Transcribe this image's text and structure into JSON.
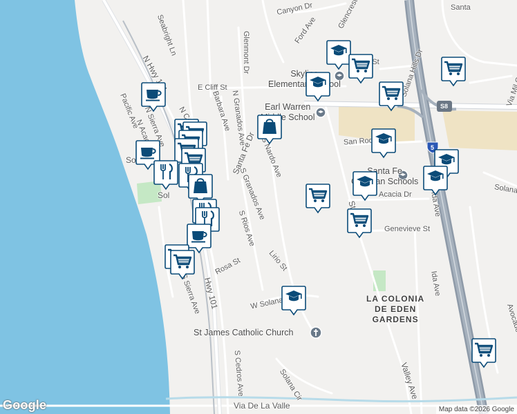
{
  "attribution": "Map data ©2026 Google",
  "logo": "Google",
  "colors": {
    "ocean": "#7fc3e3",
    "land": "#f2f1ef",
    "road": "#ffffff",
    "highway": "#8e9aa8",
    "park": "#c5e8c5",
    "commercial": "#efe3c4",
    "marker_fill": "#ffffff",
    "marker_icon": "#0b4b78"
  },
  "road_labels": [
    {
      "text": "Santa",
      "rot": 0
    },
    {
      "text": "Canyon Dr",
      "rot": -12
    },
    {
      "text": "Ford Ave",
      "rot": -55
    },
    {
      "text": "Glencrest",
      "rot": -62
    },
    {
      "text": "Seabright Ln",
      "rot": 70
    },
    {
      "text": "Glenmont Dr",
      "rot": 90
    },
    {
      "text": "N Hwy 101",
      "rot": 60
    },
    {
      "text": "E Cliff St",
      "rot": 0
    },
    {
      "text": "N Cedros",
      "rot": 60
    },
    {
      "text": "N Acacia Ave",
      "rot": 68
    },
    {
      "text": "N Sierra Ave",
      "rot": 68
    },
    {
      "text": "Pacific Ave",
      "rot": 68
    },
    {
      "text": "Barbara Ave",
      "rot": 72
    },
    {
      "text": "N Granados Ave",
      "rot": 82
    },
    {
      "text": "Santa Fe Dr",
      "rot": -68
    },
    {
      "text": "S Nardo Ave",
      "rot": 68
    },
    {
      "text": "S Granados Ave",
      "rot": 68
    },
    {
      "text": "San Rodolfo Dr",
      "rot": -4
    },
    {
      "text": "Stevens",
      "rot": 72
    },
    {
      "text": "Acacia Dr",
      "rot": 0
    },
    {
      "text": "Genevieve St",
      "rot": 0
    },
    {
      "text": "Ida Ave",
      "rot": 80
    },
    {
      "text": "Solana Hills Dr",
      "rot": -70
    },
    {
      "text": "Via Mil Cumbres",
      "rot": -70
    },
    {
      "text": "Solana",
      "rot": 10
    },
    {
      "text": "Lirio St",
      "rot": 50
    },
    {
      "text": "S Rios Ave",
      "rot": 72
    },
    {
      "text": "Rosa St",
      "rot": -28
    },
    {
      "text": "S Sierra Ave",
      "rot": 70
    },
    {
      "text": "Hwy 101",
      "rot": 76
    },
    {
      "text": "W Solana Cir",
      "rot": -12
    },
    {
      "text": "S Cedros Ave",
      "rot": 85
    },
    {
      "text": "Solana Cir",
      "rot": 58
    },
    {
      "text": "Via De La Valle",
      "rot": 0
    },
    {
      "text": "Valley Ave",
      "rot": 72
    },
    {
      "text": "Avocado",
      "rot": 72
    },
    {
      "text": "Ida Ave",
      "rot": 80
    },
    {
      "text": "Solana",
      "rot": 0
    },
    {
      "text": "Sol",
      "rot": 0
    },
    {
      "text": "Hill St",
      "rot": 0
    }
  ],
  "poi_labels": [
    {
      "text": "Skyline\nElementary School"
    },
    {
      "text": "Earl Warren\nMiddle School"
    },
    {
      "text": "Santa Fe\nChristian Schools"
    },
    {
      "text": "St James Catholic Church"
    }
  ],
  "area_labels": [
    {
      "text": "LA COLONIA\nDE EDEN\nGARDENS"
    }
  ],
  "highway_shields": [
    {
      "text": "S8",
      "icon": "county-route-shield-icon"
    },
    {
      "text": "5",
      "icon": "interstate-shield-icon"
    }
  ],
  "markers": [
    {
      "icon": "school-icon"
    },
    {
      "icon": "shopping-cart-icon"
    },
    {
      "icon": "school-icon"
    },
    {
      "icon": "shopping-cart-icon"
    },
    {
      "icon": "shopping-cart-icon"
    },
    {
      "icon": "shopping-bag-icon"
    },
    {
      "icon": "school-icon"
    },
    {
      "icon": "school-icon"
    },
    {
      "icon": "school-icon"
    },
    {
      "icon": "shopping-cart-icon"
    },
    {
      "icon": "school-icon"
    },
    {
      "icon": "shopping-cart-icon"
    },
    {
      "icon": "coffee-cup-icon"
    },
    {
      "icon": "shopping-cart-icon"
    },
    {
      "icon": "shopping-cart-icon"
    },
    {
      "icon": "shopping-cart-icon"
    },
    {
      "icon": "shopping-cart-icon"
    },
    {
      "icon": "coffee-cup-icon"
    },
    {
      "icon": "shopping-cart-icon"
    },
    {
      "icon": "fork-knife-icon"
    },
    {
      "icon": "fork-knife-icon"
    },
    {
      "icon": "shopping-bag-icon"
    },
    {
      "icon": "fork-knife-icon"
    },
    {
      "icon": "fork-knife-icon"
    },
    {
      "icon": "coffee-cup-icon"
    },
    {
      "icon": "shopping-cart-icon"
    },
    {
      "icon": "shopping-cart-icon"
    },
    {
      "icon": "school-icon"
    },
    {
      "icon": "shopping-cart-icon"
    }
  ]
}
